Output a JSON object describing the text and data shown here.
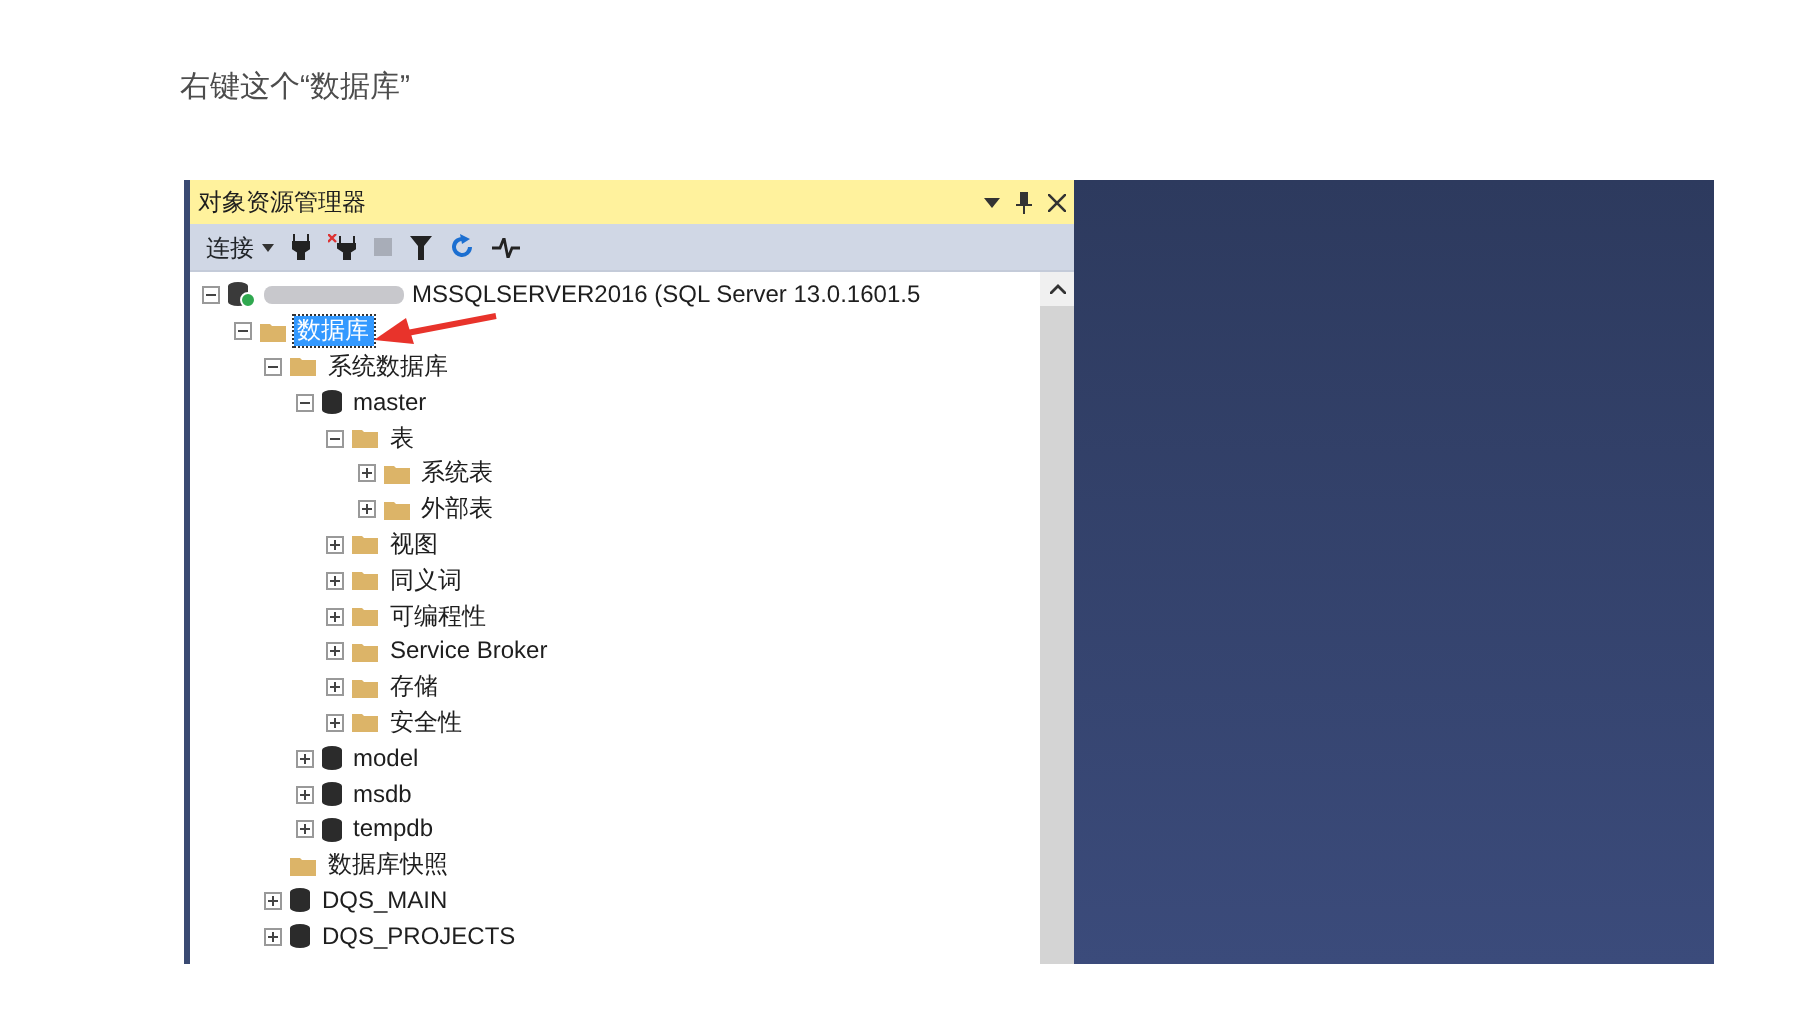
{
  "heading": "右键这个“数据库”",
  "explorer": {
    "title": "对象资源管理器",
    "connect_label": "连接",
    "tree": [
      {
        "label": "MSSQLSERVER2016 (SQL Server 13.0.1601.5",
        "kind": "server",
        "expanded": true,
        "selected": false,
        "children": [
          {
            "label": "数据库",
            "kind": "folder",
            "expanded": true,
            "selected": true,
            "children": [
              {
                "label": "系统数据库",
                "kind": "folder",
                "expanded": true,
                "selected": false,
                "children": [
                  {
                    "label": "master",
                    "kind": "database",
                    "expanded": true,
                    "selected": false,
                    "children": [
                      {
                        "label": "表",
                        "kind": "folder",
                        "expanded": true,
                        "selected": false,
                        "children": [
                          {
                            "label": "系统表",
                            "kind": "folder",
                            "expanded": false,
                            "selected": false
                          },
                          {
                            "label": "外部表",
                            "kind": "folder",
                            "expanded": false,
                            "selected": false
                          }
                        ]
                      },
                      {
                        "label": "视图",
                        "kind": "folder",
                        "expanded": false,
                        "selected": false
                      },
                      {
                        "label": "同义词",
                        "kind": "folder",
                        "expanded": false,
                        "selected": false
                      },
                      {
                        "label": "可编程性",
                        "kind": "folder",
                        "expanded": false,
                        "selected": false
                      },
                      {
                        "label": "Service Broker",
                        "kind": "folder",
                        "expanded": false,
                        "selected": false
                      },
                      {
                        "label": "存储",
                        "kind": "folder",
                        "expanded": false,
                        "selected": false
                      },
                      {
                        "label": "安全性",
                        "kind": "folder",
                        "expanded": false,
                        "selected": false
                      }
                    ]
                  },
                  {
                    "label": "model",
                    "kind": "database",
                    "expanded": false,
                    "selected": false
                  },
                  {
                    "label": "msdb",
                    "kind": "database",
                    "expanded": false,
                    "selected": false
                  },
                  {
                    "label": "tempdb",
                    "kind": "database",
                    "expanded": false,
                    "selected": false
                  }
                ]
              },
              {
                "label": "数据库快照",
                "kind": "folder",
                "selected": false
              },
              {
                "label": "DQS_MAIN",
                "kind": "database",
                "expanded": false,
                "selected": false
              },
              {
                "label": "DQS_PROJECTS",
                "kind": "database",
                "expanded": false,
                "selected": false
              }
            ]
          }
        ]
      }
    ]
  }
}
